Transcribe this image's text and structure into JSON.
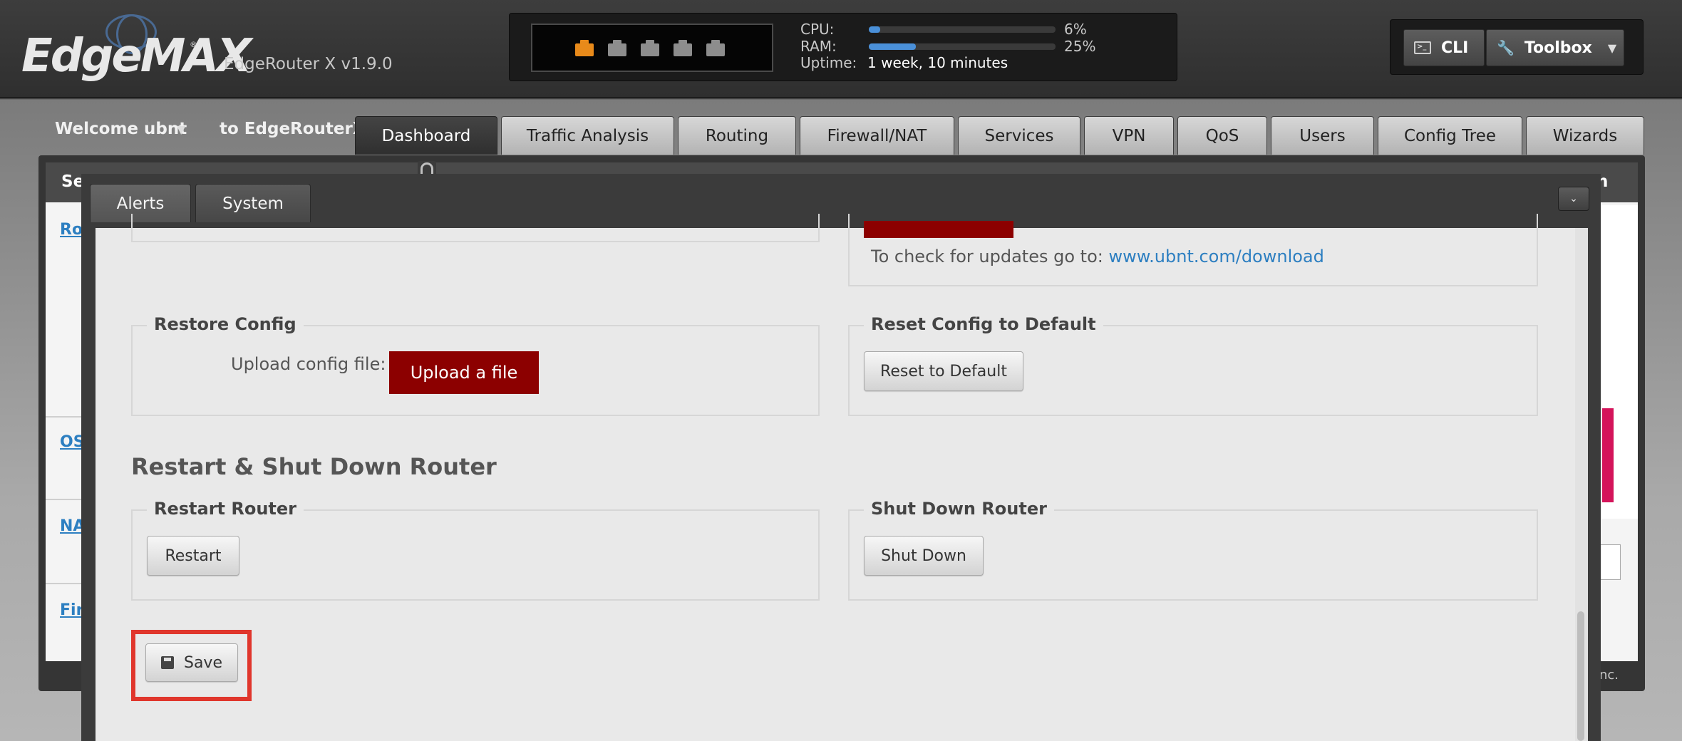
{
  "header": {
    "logo": "EdgeMAX",
    "router_version": "EdgeRouter X v1.9.0",
    "status": {
      "cpu_label": "CPU:",
      "cpu_value": "6%",
      "cpu_fraction": 0.06,
      "ram_label": "RAM:",
      "ram_value": "25%",
      "ram_fraction": 0.25,
      "uptime_label": "Uptime:",
      "uptime_value": "1 week, 10 minutes",
      "ports": [
        {
          "name": "port-0",
          "state": "up",
          "color": "#e88a1a"
        },
        {
          "name": "port-1",
          "state": "down",
          "color": "#8d8d8d"
        },
        {
          "name": "port-2",
          "state": "down",
          "color": "#8d8d8d"
        },
        {
          "name": "port-3",
          "state": "down",
          "color": "#8d8d8d"
        },
        {
          "name": "port-4",
          "state": "down",
          "color": "#8d8d8d"
        }
      ]
    },
    "tools": {
      "cli_label": "CLI",
      "cli_icon": "terminal-icon",
      "toolbox_label": "Toolbox",
      "toolbox_icon": "wrench-icon"
    }
  },
  "nav": {
    "welcome": "Welcome ubnt",
    "to_router": "to EdgeRouterX",
    "tabs": [
      "Dashboard",
      "Traffic Analysis",
      "Routing",
      "Firewall/NAT",
      "Services",
      "VPN",
      "QoS",
      "Users",
      "Config Tree",
      "Wizards"
    ],
    "active_tab": "Dashboard"
  },
  "background": {
    "header_left": "Se",
    "header_right": "n",
    "links": [
      "Ro",
      "OS",
      "NA",
      "Fir"
    ],
    "copyright_fragment": "nc."
  },
  "drawer": {
    "tabs": [
      "Alerts",
      "System"
    ],
    "active_tab": "System",
    "updates_text": "To check for updates go to: ",
    "updates_link": "www.ubnt.com/download",
    "restore_config": {
      "legend": "Restore Config",
      "label": "Upload config file:",
      "button": "Upload a file"
    },
    "reset_config": {
      "legend": "Reset Config to Default",
      "button": "Reset to Default"
    },
    "section_heading": "Restart & Shut Down Router",
    "restart": {
      "legend": "Restart Router",
      "button": "Restart"
    },
    "shutdown": {
      "legend": "Shut Down Router",
      "button": "Shut Down"
    },
    "save_button": "Save",
    "save_highlight_color": "#e0362c"
  },
  "colors": {
    "accent_blue": "#4a90d9",
    "link_blue": "#2d7fc1",
    "dark_red": "#8c0000",
    "port_active": "#e88a1a"
  }
}
